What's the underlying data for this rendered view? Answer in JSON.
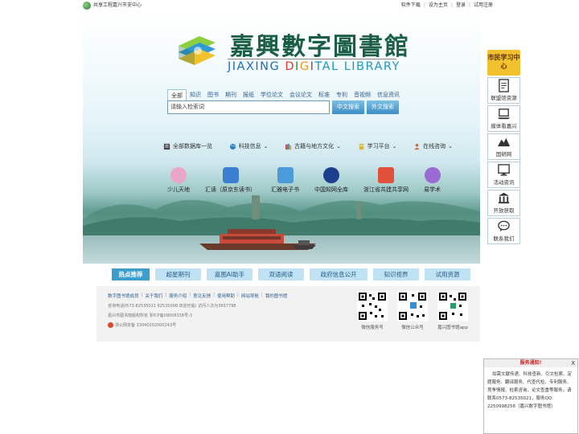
{
  "topbar": {
    "left_text": "共享工程嘉兴市支中心",
    "links": [
      "软件下载",
      "设为主页",
      "登录",
      "试用注册"
    ]
  },
  "header": {
    "title_cn": "嘉興數字圖書館",
    "title_en_parts": [
      "JIAXING ",
      "D",
      "I",
      "G",
      "I",
      "TAL LIBRARY"
    ]
  },
  "search": {
    "tabs": [
      "全部",
      "知识",
      "图书",
      "期刊",
      "报纸",
      "学位论文",
      "会议论文",
      "标准",
      "专利",
      "音视频",
      "信息资讯"
    ],
    "active_tab": "全部",
    "placeholder": "请输入检索词",
    "btn_cn": "中文搜索",
    "btn_foreign": "外文搜索"
  },
  "nav": [
    {
      "label": "全部数据库一览",
      "icon": "database-icon"
    },
    {
      "label": "科技信息",
      "icon": "globe-icon"
    },
    {
      "label": "古籍与地方文化",
      "icon": "books-icon"
    },
    {
      "label": "学习平台",
      "icon": "notebook-icon"
    },
    {
      "label": "在线咨询",
      "icon": "person-icon"
    }
  ],
  "resources": [
    {
      "label": "少儿天地",
      "color": "#e9a6c6"
    },
    {
      "label": "汇读（原京东读书）",
      "color": "#3b7fd0"
    },
    {
      "label": "汇雅电子书",
      "color": "#4a9bd8"
    },
    {
      "label": "中国知网全库",
      "color": "#1e3f8f"
    },
    {
      "label": "浙江省共建共享网",
      "color": "#e0503a"
    },
    {
      "label": "易学术",
      "color": "#9b6bd3"
    }
  ],
  "hot_tabs": [
    "热点推荐",
    "超星期刊",
    "嘉图AI助手",
    "双语阅读",
    "政府信息公开",
    "知识视界",
    "试用资源"
  ],
  "footer": {
    "links": [
      "数字图书馆成员",
      "关于我们",
      "服务介绍",
      "意见反馈",
      "使用帮助",
      "网站导航",
      "我的图书馆"
    ],
    "phone": "咨询电话0573-82535021 82535008  欢迎光临! 访问人次为3657798",
    "copyright": "嘉兴市图书馆版权所有   浙ICP备09008338号-3",
    "police": "浙公网安备 33040202000243号",
    "qrs": [
      "微信服务号",
      "微信公众号",
      "嘉兴图书馆app"
    ]
  },
  "side": {
    "head": "市民学习中心",
    "items": [
      {
        "label": "联盟馆资源",
        "icon": "document-icon"
      },
      {
        "label": "媒体看嘉兴",
        "icon": "laptop-icon"
      },
      {
        "label": "国研网",
        "icon": "mountain-icon"
      },
      {
        "label": "活动资讯",
        "icon": "monitor-icon"
      },
      {
        "label": "开放获取",
        "icon": "building-icon"
      },
      {
        "label": "联系我们",
        "icon": "chat-icon"
      }
    ]
  },
  "notice": {
    "title": "服务通知!",
    "close": "X",
    "body": "如需文献传递、科技查新、引文检索、定题服务、翻译服务、代查代检、专利服务、竞争情报、检索咨询、论文查重等服务，请联系0573-82535021，服务QQ: 2250998256（嘉兴数字图书馆）"
  }
}
